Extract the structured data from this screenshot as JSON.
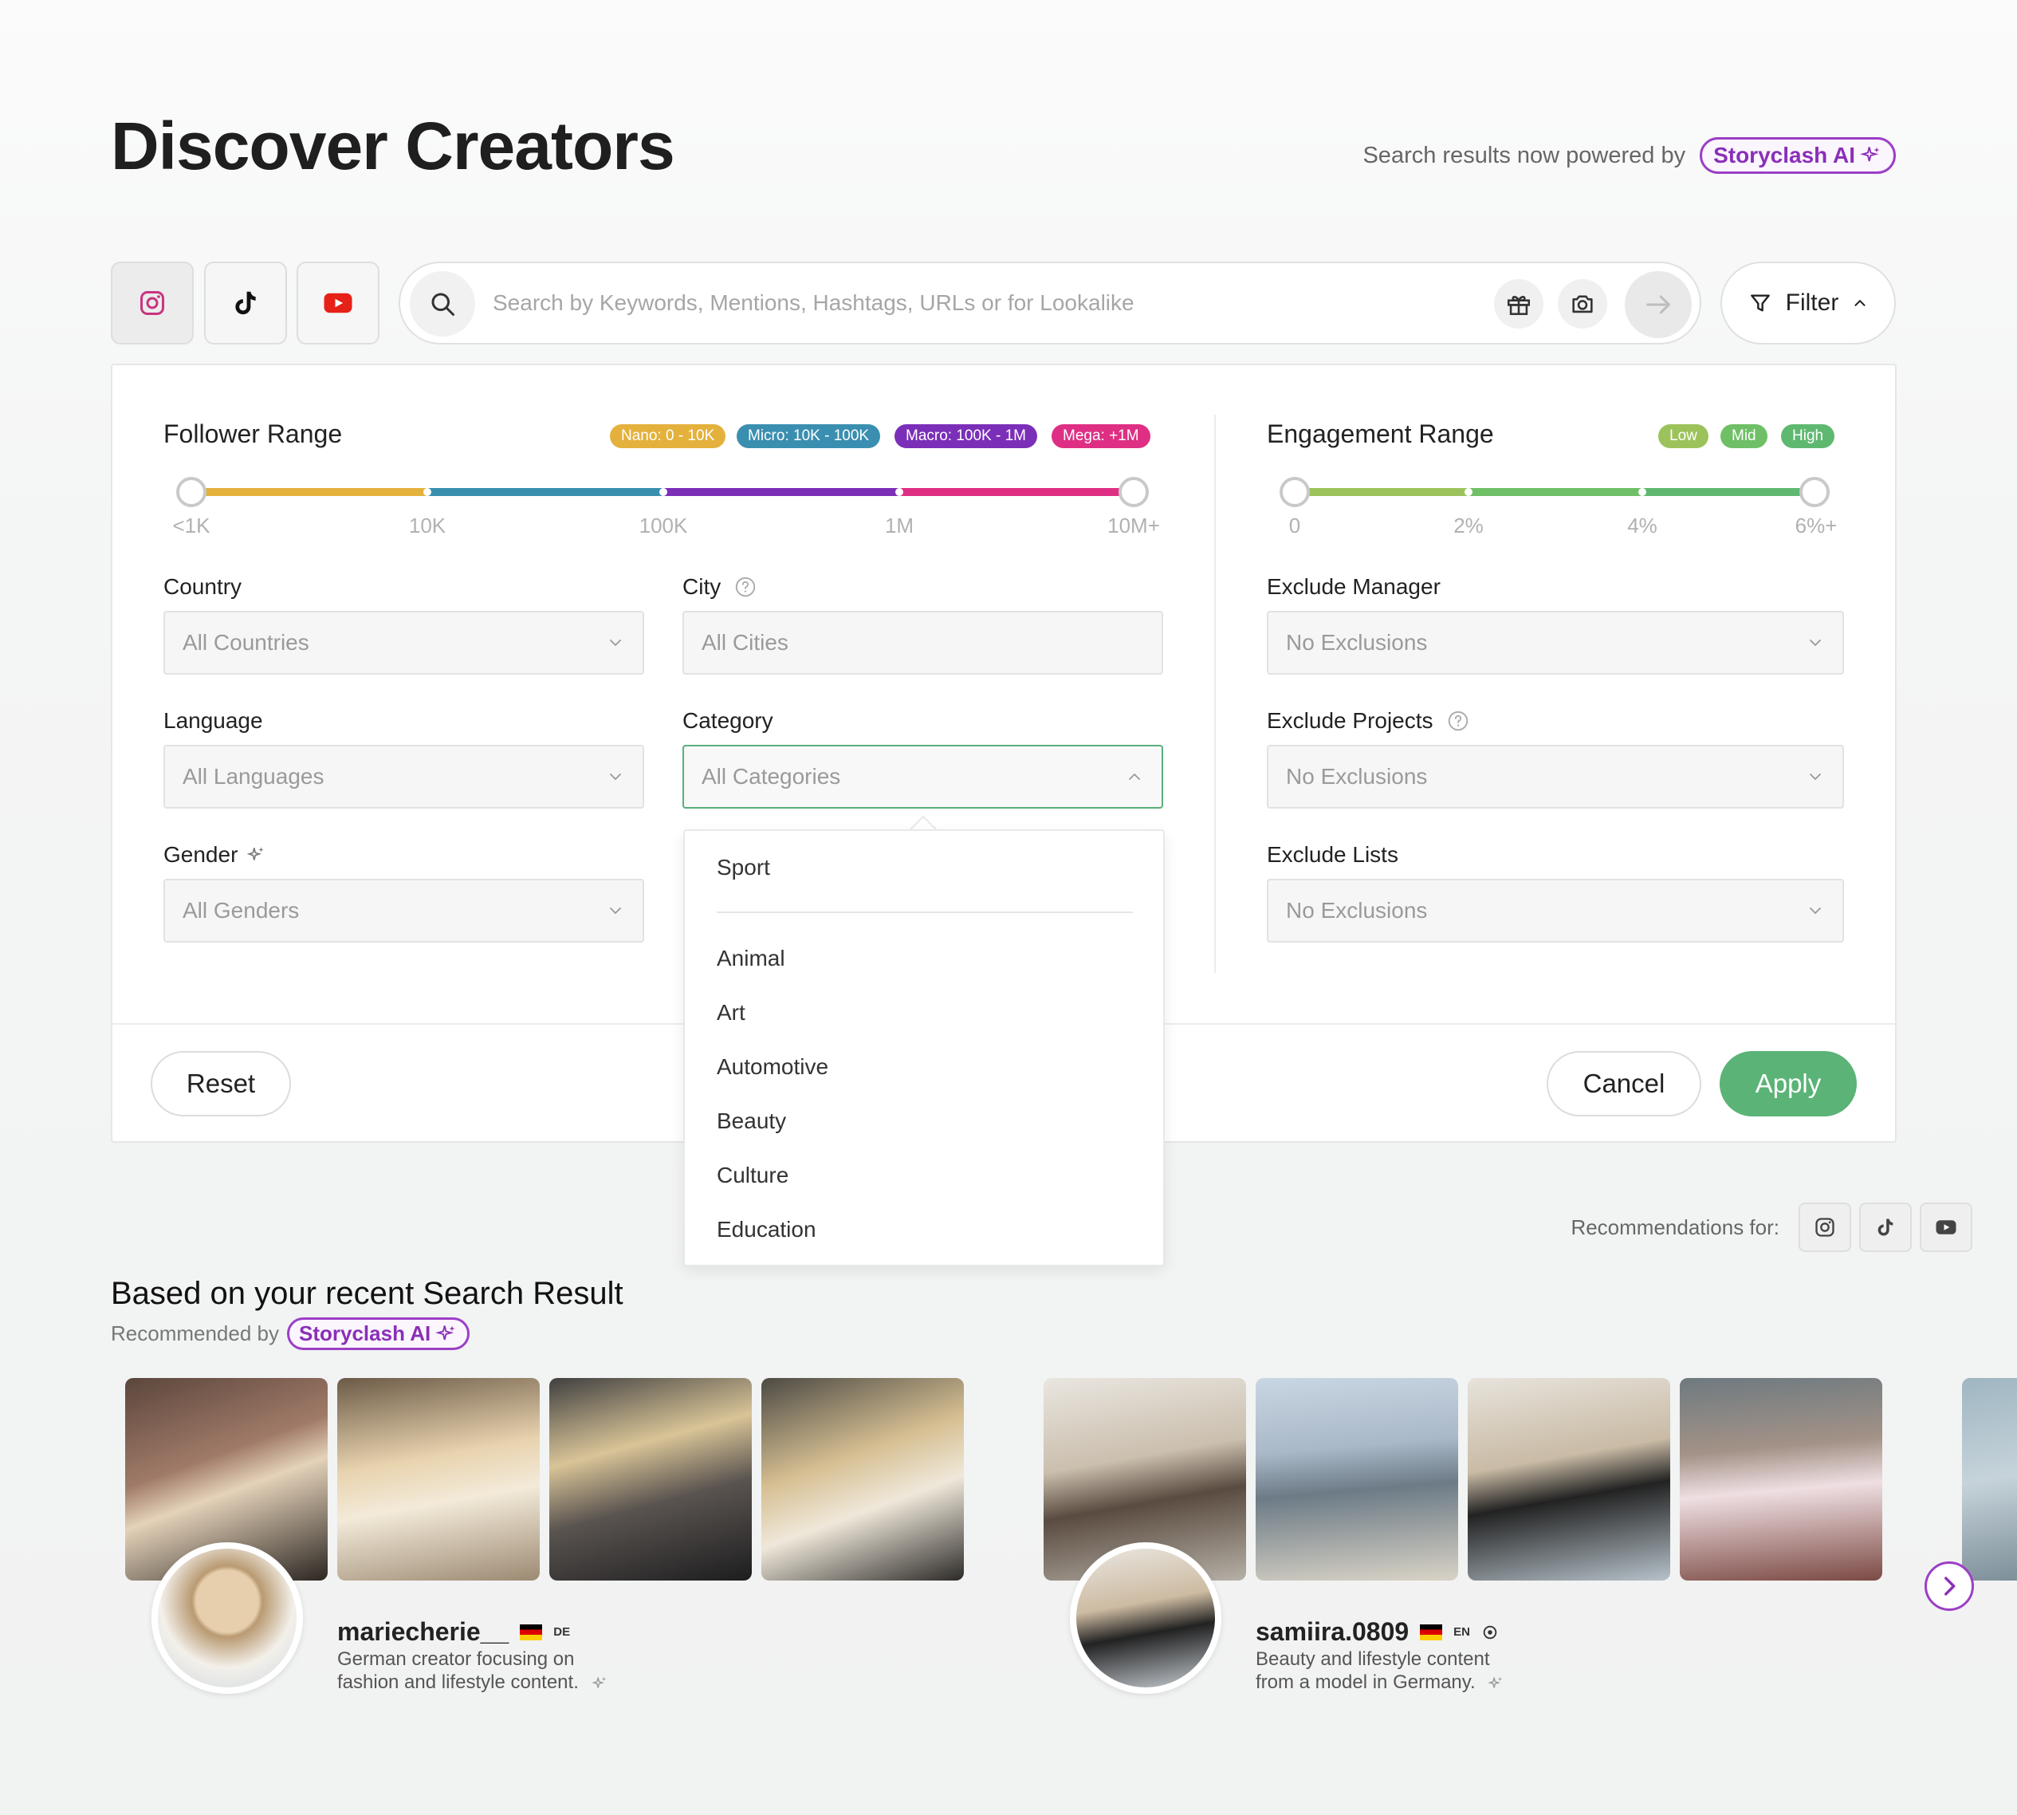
{
  "page": {
    "title": "Discover Creators",
    "powered_text": "Search results now powered by",
    "ai_label": "Storyclash AI"
  },
  "colors": {
    "accent_purple": "#9b3fc6",
    "apply_green": "#5bb377",
    "nano": "#e4b13c",
    "micro": "#3a8fb0",
    "macro": "#7b2fb8",
    "mega": "#df2f84",
    "eng_low": "#9cc35b",
    "eng_mid": "#6fbf66",
    "eng_high": "#5fb870"
  },
  "platforms": [
    {
      "name": "instagram",
      "icon": "instagram-icon",
      "active": true
    },
    {
      "name": "tiktok",
      "icon": "tiktok-icon",
      "active": false
    },
    {
      "name": "youtube",
      "icon": "youtube-icon",
      "active": false
    }
  ],
  "search": {
    "placeholder": "Search by Keywords, Mentions, Hashtags, URLs or for Lookalike"
  },
  "filter": {
    "label": "Filter"
  },
  "follower": {
    "title": "Follower Range",
    "badges": [
      "Nano: 0 - 10K",
      "Micro: 10K - 100K",
      "Macro: 100K - 1M",
      "Mega: +1M"
    ],
    "ticks": [
      "<1K",
      "10K",
      "100K",
      "1M",
      "10M+"
    ]
  },
  "engagement": {
    "title": "Engagement Range",
    "badges": [
      "Low",
      "Mid",
      "High"
    ],
    "ticks": [
      "0",
      "2%",
      "4%",
      "6%+"
    ]
  },
  "fields": {
    "country": {
      "label": "Country",
      "value": "All Countries"
    },
    "city": {
      "label": "City",
      "value": "All Cities"
    },
    "language": {
      "label": "Language",
      "value": "All Languages"
    },
    "category": {
      "label": "Category",
      "value": "All Categories"
    },
    "gender": {
      "label": "Gender",
      "value": "All Genders"
    },
    "exclude_manager": {
      "label": "Exclude Manager",
      "value": "No Exclusions"
    },
    "exclude_projects": {
      "label": "Exclude Projects",
      "value": "No Exclusions"
    },
    "exclude_lists": {
      "label": "Exclude Lists",
      "value": "No Exclusions"
    }
  },
  "category_dropdown": {
    "pinned": "Sport",
    "items": [
      "Animal",
      "Art",
      "Automotive",
      "Beauty",
      "Culture",
      "Education"
    ]
  },
  "actions": {
    "reset": "Reset",
    "cancel": "Cancel",
    "apply": "Apply"
  },
  "recommendations": {
    "label": "Recommendations for:",
    "section_title": "Based on your recent Search Result",
    "recommended_by": "Recommended by",
    "ai_label": "Storyclash AI",
    "creators": [
      {
        "username": "mariecherie__",
        "lang": "DE",
        "description": "German creator focusing on fashion and lifestyle content."
      },
      {
        "username": "samiira.0809",
        "lang": "EN",
        "description": "Beauty and lifestyle content from a model in Germany."
      }
    ]
  }
}
